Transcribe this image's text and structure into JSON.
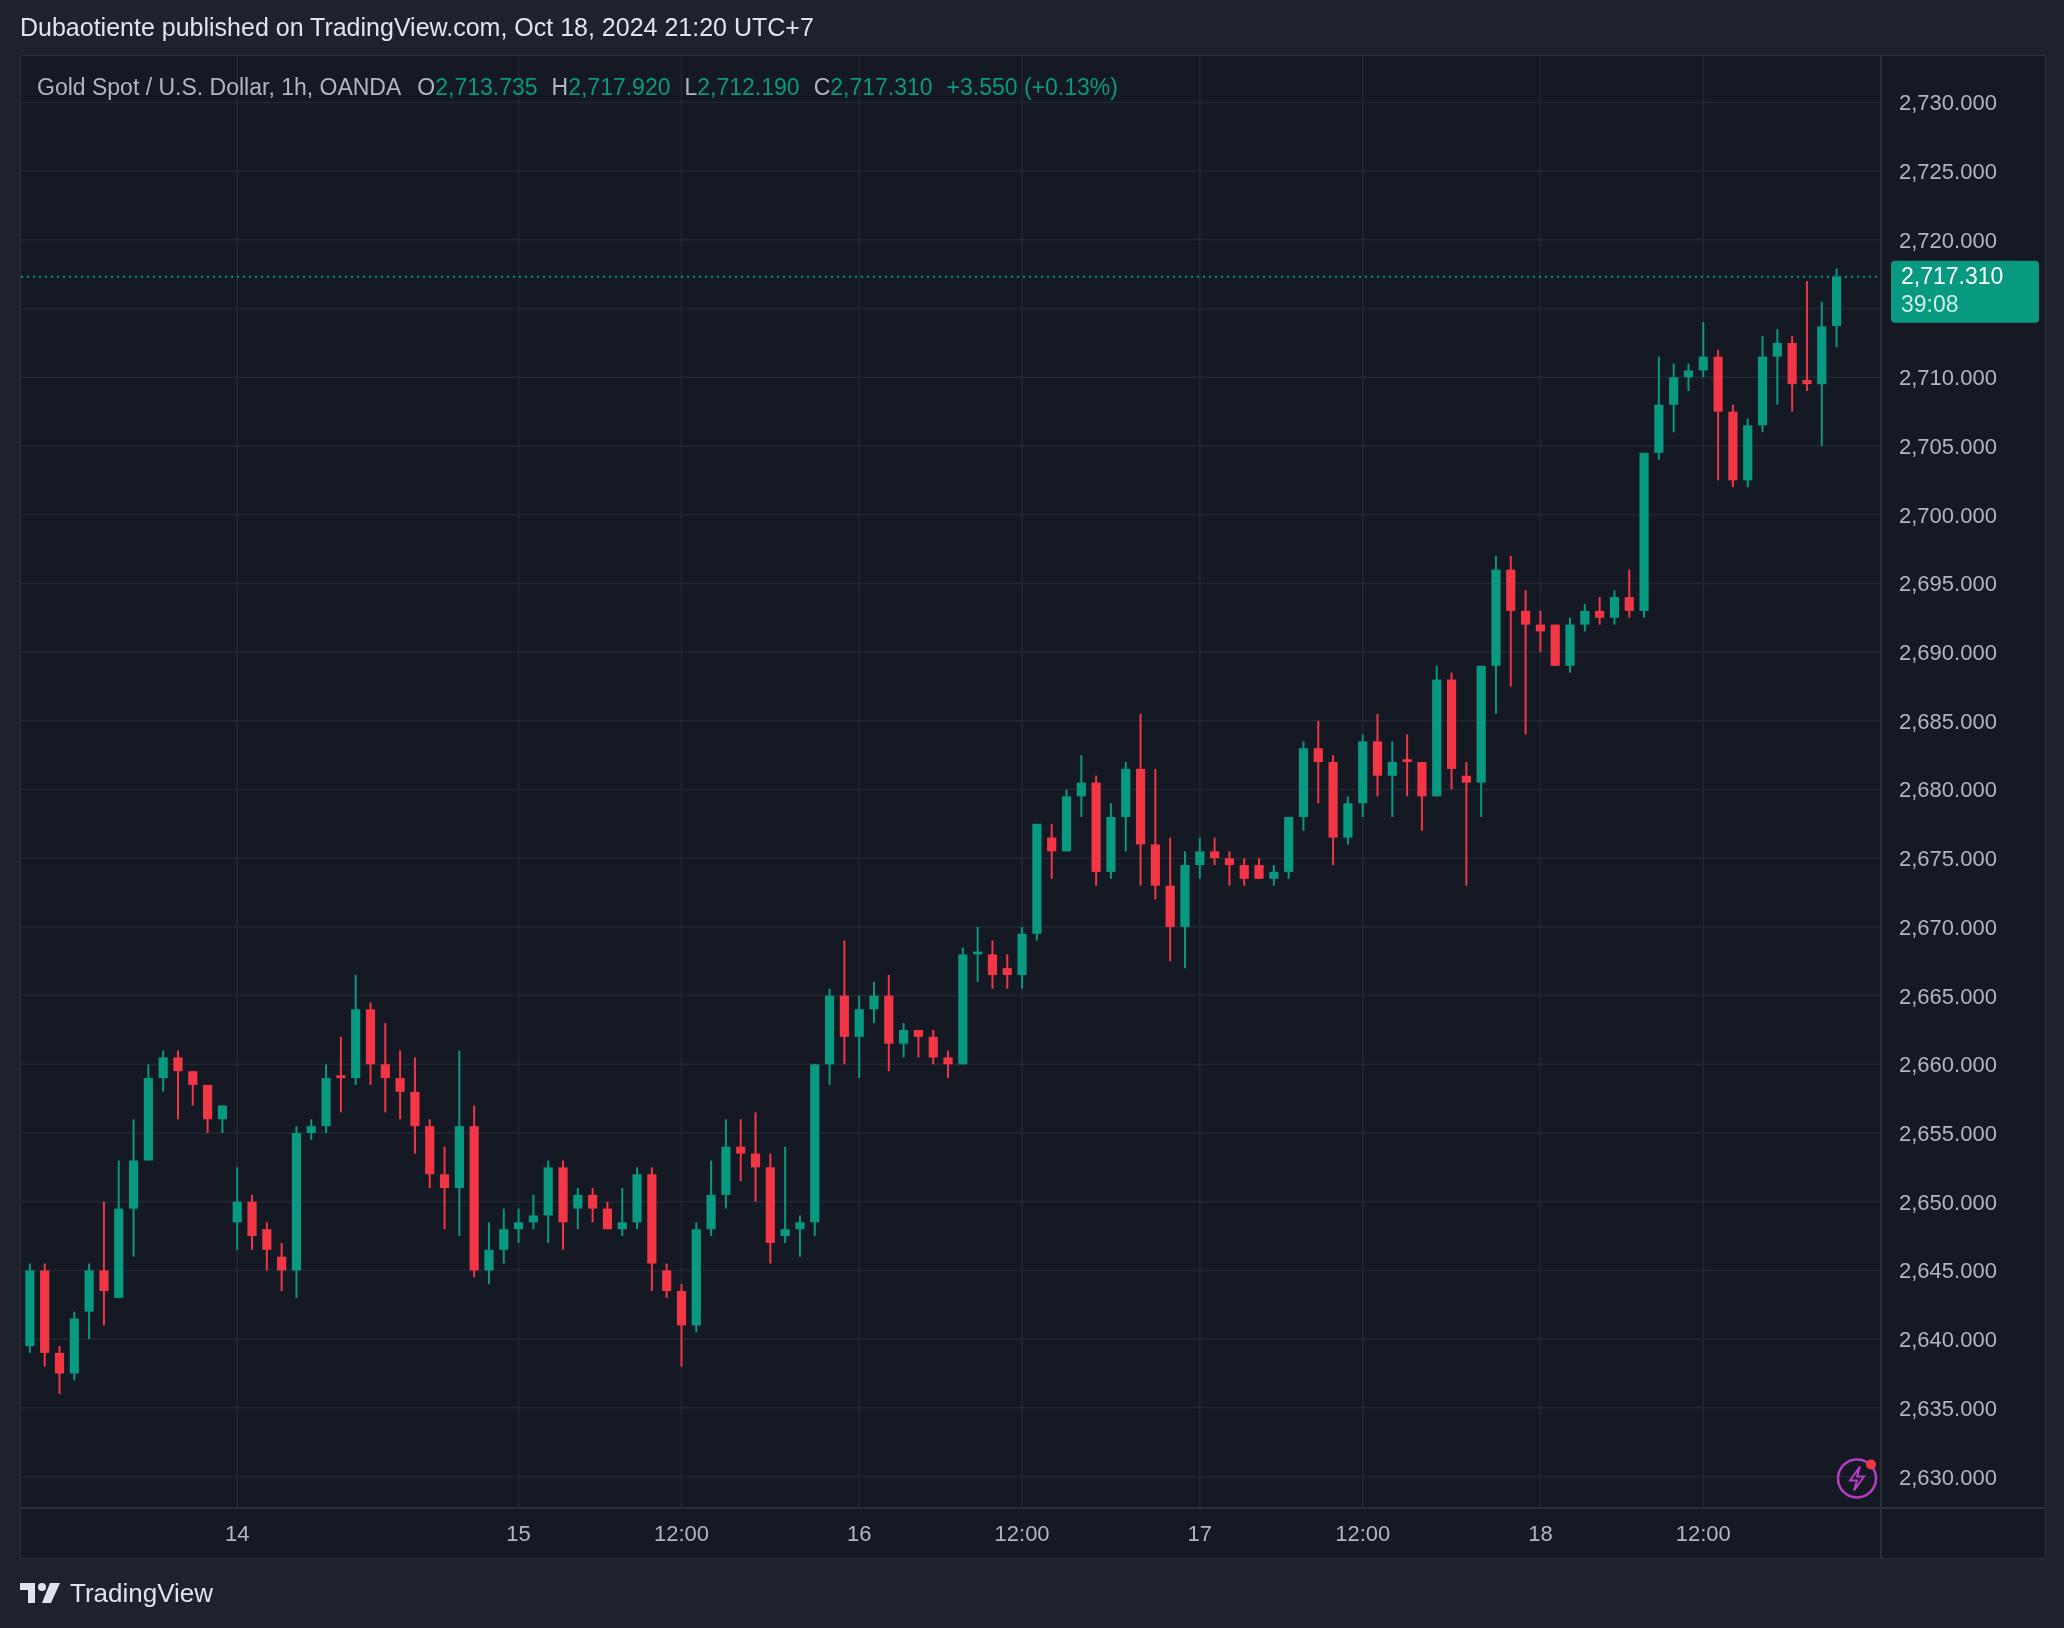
{
  "header": {
    "text": "Dubaotiente published on TradingView.com, Oct 18, 2024 21:20 UTC+7"
  },
  "legend": {
    "symbol": "Gold Spot / U.S. Dollar, 1h, OANDA",
    "values": [
      {
        "label": "O",
        "value": "2,713.735"
      },
      {
        "label": "H",
        "value": "2,717.920"
      },
      {
        "label": "L",
        "value": "2,712.190"
      },
      {
        "label": "C",
        "value": "2,717.310"
      }
    ],
    "change": "+3.550 (+0.13%)"
  },
  "price_label": {
    "price": "2,717.310",
    "countdown": "39:08"
  },
  "chart_data": {
    "type": "candlestick",
    "ylim": [
      2627.71,
      2733.38
    ],
    "grid": true,
    "ref_lines": [
      {
        "axis": "y",
        "value": 2717.31
      }
    ],
    "categories": [
      null,
      null,
      null,
      null,
      null,
      null,
      null,
      null,
      null,
      null,
      null,
      null,
      null,
      null,
      "14",
      null,
      null,
      null,
      null,
      null,
      null,
      null,
      null,
      null,
      null,
      null,
      null,
      null,
      null,
      null,
      null,
      null,
      null,
      "15",
      null,
      null,
      null,
      null,
      null,
      null,
      null,
      null,
      null,
      null,
      "12:00",
      null,
      null,
      null,
      null,
      null,
      null,
      null,
      null,
      null,
      null,
      null,
      "16",
      null,
      null,
      null,
      null,
      null,
      null,
      null,
      null,
      null,
      null,
      "12:00",
      null,
      null,
      null,
      null,
      null,
      null,
      null,
      null,
      null,
      null,
      null,
      "17",
      null,
      null,
      null,
      null,
      null,
      null,
      null,
      null,
      null,
      null,
      "12:00",
      null,
      null,
      null,
      null,
      null,
      null,
      null,
      null,
      null,
      null,
      null,
      "18",
      null,
      null,
      null,
      null,
      null,
      null,
      null,
      null,
      null,
      null,
      "12:00",
      null,
      null,
      null,
      null,
      null,
      null,
      null,
      null,
      null
    ],
    "yticks": [
      {
        "value": 2630,
        "label": "2,630.000"
      },
      {
        "value": 2635,
        "label": "2,635.000"
      },
      {
        "value": 2640,
        "label": "2,640.000"
      },
      {
        "value": 2645,
        "label": "2,645.000"
      },
      {
        "value": 2650,
        "label": "2,650.000"
      },
      {
        "value": 2655,
        "label": "2,655.000"
      },
      {
        "value": 2660,
        "label": "2,660.000"
      },
      {
        "value": 2665,
        "label": "2,665.000"
      },
      {
        "value": 2670,
        "label": "2,670.000"
      },
      {
        "value": 2675,
        "label": "2,675.000"
      },
      {
        "value": 2680,
        "label": "2,680.000"
      },
      {
        "value": 2685,
        "label": "2,685.000"
      },
      {
        "value": 2690,
        "label": "2,690.000"
      },
      {
        "value": 2695,
        "label": "2,695.000"
      },
      {
        "value": 2700,
        "label": "2,700.000"
      },
      {
        "value": 2705,
        "label": "2,705.000"
      },
      {
        "value": 2710,
        "label": "2,710.000"
      },
      {
        "value": 2720,
        "label": "2,720.000"
      },
      {
        "value": 2725,
        "label": "2,725.000"
      },
      {
        "value": 2730,
        "label": "2,730.000"
      }
    ],
    "ohlc": [
      [
        2639.5,
        2645.5,
        2639,
        2645
      ],
      [
        2645,
        2645.5,
        2638,
        2639
      ],
      [
        2639,
        2639.5,
        2636,
        2637.5
      ],
      [
        2637.5,
        2642,
        2637,
        2641.5
      ],
      [
        2642,
        2645.5,
        2640,
        2645
      ],
      [
        2645,
        2650,
        2641,
        2643.5
      ],
      [
        2643,
        2653,
        2643,
        2649.5
      ],
      [
        2649.5,
        2656,
        2646,
        2653
      ],
      [
        2653,
        2660,
        2653,
        2659
      ],
      [
        2659,
        2661,
        2658,
        2660.5
      ],
      [
        2660.5,
        2661,
        2656,
        2659.5
      ],
      [
        2659.5,
        2659.5,
        2657,
        2658.5
      ],
      [
        2658.5,
        2658.5,
        2655,
        2656
      ],
      [
        2656,
        2657,
        2655,
        2657
      ],
      [
        2648.5,
        2652.5,
        2646.5,
        2650
      ],
      [
        2650,
        2650.5,
        2646.5,
        2647.5
      ],
      [
        2648,
        2648.5,
        2645,
        2646.5
      ],
      [
        2646,
        2647,
        2643.5,
        2645
      ],
      [
        2645,
        2655.5,
        2643,
        2655
      ],
      [
        2655,
        2656,
        2654.5,
        2655.5
      ],
      [
        2655.5,
        2660,
        2655,
        2659
      ],
      [
        2659.2,
        2662,
        2656.5,
        2659
      ],
      [
        2659,
        2666.5,
        2658.5,
        2664
      ],
      [
        2664,
        2664.5,
        2658.5,
        2660
      ],
      [
        2660,
        2663,
        2656.5,
        2659
      ],
      [
        2659,
        2661,
        2656,
        2658
      ],
      [
        2658,
        2660.5,
        2653.5,
        2655.5
      ],
      [
        2655.5,
        2656,
        2651,
        2652
      ],
      [
        2652,
        2654,
        2648,
        2651
      ],
      [
        2651,
        2661,
        2647.5,
        2655.5
      ],
      [
        2655.5,
        2657,
        2644.5,
        2645
      ],
      [
        2645,
        2648.5,
        2644,
        2646.5
      ],
      [
        2646.5,
        2649.5,
        2645.5,
        2648
      ],
      [
        2648,
        2649.5,
        2647,
        2648.5
      ],
      [
        2648.5,
        2650.5,
        2648,
        2649
      ],
      [
        2649,
        2653,
        2647,
        2652.5
      ],
      [
        2652.5,
        2653,
        2646.5,
        2648.5
      ],
      [
        2649.5,
        2651,
        2648,
        2650.5
      ],
      [
        2650.5,
        2651,
        2648.5,
        2649.5
      ],
      [
        2649.5,
        2650,
        2648,
        2648
      ],
      [
        2648,
        2651,
        2647.5,
        2648.5
      ],
      [
        2648.5,
        2652.5,
        2648,
        2652
      ],
      [
        2652,
        2652.5,
        2643.5,
        2645.5
      ],
      [
        2645,
        2645.5,
        2643,
        2643.5
      ],
      [
        2643.5,
        2644,
        2638,
        2641
      ],
      [
        2641,
        2648.5,
        2640.5,
        2648
      ],
      [
        2648,
        2653,
        2647.5,
        2650.5
      ],
      [
        2650.5,
        2656,
        2649.5,
        2654
      ],
      [
        2654,
        2656,
        2651.5,
        2653.5
      ],
      [
        2653.5,
        2656.5,
        2650,
        2652.5
      ],
      [
        2652.5,
        2653.5,
        2645.5,
        2647
      ],
      [
        2647.5,
        2654,
        2647,
        2648
      ],
      [
        2648,
        2649,
        2646,
        2648.5
      ],
      [
        2648.5,
        2660,
        2647.5,
        2660
      ],
      [
        2660,
        2665.5,
        2658.5,
        2665
      ],
      [
        2665,
        2669,
        2660,
        2662
      ],
      [
        2662,
        2665,
        2659,
        2664
      ],
      [
        2664,
        2666,
        2663,
        2665
      ],
      [
        2665,
        2666.5,
        2659.5,
        2661.5
      ],
      [
        2661.5,
        2663,
        2660.5,
        2662.5
      ],
      [
        2662.5,
        2662.5,
        2660.5,
        2662
      ],
      [
        2662,
        2662.5,
        2660,
        2660.5
      ],
      [
        2660.5,
        2661,
        2659,
        2660
      ],
      [
        2660,
        2668.5,
        2660,
        2668
      ],
      [
        2668,
        2670,
        2666,
        2668.2
      ],
      [
        2668,
        2669,
        2665.5,
        2666.5
      ],
      [
        2667,
        2668,
        2665.5,
        2666.5
      ],
      [
        2666.5,
        2670,
        2665.5,
        2669.5
      ],
      [
        2669.5,
        2677.5,
        2669,
        2677.5
      ],
      [
        2676.5,
        2677.5,
        2673.5,
        2675.5
      ],
      [
        2675.5,
        2680,
        2675.5,
        2679.5
      ],
      [
        2679.5,
        2682.5,
        2678,
        2680.5
      ],
      [
        2680.5,
        2681,
        2673,
        2674
      ],
      [
        2674,
        2679,
        2673.5,
        2678
      ],
      [
        2678,
        2682,
        2675.5,
        2681.5
      ],
      [
        2681.5,
        2685.5,
        2673,
        2676
      ],
      [
        2676,
        2681.5,
        2672,
        2673
      ],
      [
        2673,
        2676.5,
        2667.5,
        2670
      ],
      [
        2670,
        2675.5,
        2667,
        2674.5
      ],
      [
        2674.5,
        2676.5,
        2673.5,
        2675.5
      ],
      [
        2675.5,
        2676.5,
        2674.5,
        2675
      ],
      [
        2675,
        2675.5,
        2673,
        2674.5
      ],
      [
        2674.5,
        2675,
        2673,
        2673.5
      ],
      [
        2674.5,
        2675,
        2673.5,
        2673.5
      ],
      [
        2673.5,
        2674.5,
        2673,
        2674
      ],
      [
        2674,
        2678,
        2673.5,
        2678
      ],
      [
        2678,
        2683.5,
        2677,
        2683
      ],
      [
        2683,
        2685,
        2679,
        2682
      ],
      [
        2682,
        2682.5,
        2674.5,
        2676.5
      ],
      [
        2676.5,
        2679.5,
        2676,
        2679
      ],
      [
        2679,
        2684,
        2678,
        2683.5
      ],
      [
        2683.5,
        2685.5,
        2679.5,
        2681
      ],
      [
        2681,
        2683.5,
        2678,
        2682
      ],
      [
        2682.2,
        2684,
        2679.5,
        2682
      ],
      [
        2682,
        2682,
        2677,
        2679.5
      ],
      [
        2679.5,
        2689,
        2679.5,
        2688
      ],
      [
        2688,
        2688.5,
        2680,
        2681.5
      ],
      [
        2681,
        2682,
        2673,
        2680.5
      ],
      [
        2680.5,
        2689,
        2678,
        2689
      ],
      [
        2689,
        2697,
        2685.5,
        2696
      ],
      [
        2696,
        2697,
        2687.5,
        2693
      ],
      [
        2693,
        2694.5,
        2684,
        2692
      ],
      [
        2692,
        2693,
        2690,
        2691.5
      ],
      [
        2692,
        2692,
        2689,
        2689
      ],
      [
        2689,
        2692.5,
        2688.5,
        2692
      ],
      [
        2692,
        2693.5,
        2691.5,
        2693
      ],
      [
        2693,
        2694,
        2692,
        2692.5
      ],
      [
        2692.5,
        2694.5,
        2692,
        2694
      ],
      [
        2694,
        2696,
        2692.5,
        2693
      ],
      [
        2693,
        2704.5,
        2692.5,
        2704.5
      ],
      [
        2704.5,
        2711.5,
        2704,
        2708
      ],
      [
        2708,
        2711,
        2706,
        2710
      ],
      [
        2710,
        2711,
        2709,
        2710.5
      ],
      [
        2710.5,
        2714,
        2710,
        2711.5
      ],
      [
        2711.5,
        2712,
        2702.5,
        2707.5
      ],
      [
        2707.5,
        2708,
        2702,
        2702.5
      ],
      [
        2702.5,
        2707,
        2702,
        2706.5
      ],
      [
        2706.5,
        2713,
        2706,
        2711.5
      ],
      [
        2711.5,
        2713.5,
        2708,
        2712.5
      ],
      [
        2712.5,
        2713,
        2707.5,
        2709.5
      ],
      [
        2709.8,
        2717,
        2709,
        2709.5
      ],
      [
        2709.5,
        2715.5,
        2705,
        2713.7
      ],
      [
        2713.735,
        2717.92,
        2712.19,
        2717.31
      ]
    ]
  },
  "footer": {
    "brand": "TradingView"
  }
}
